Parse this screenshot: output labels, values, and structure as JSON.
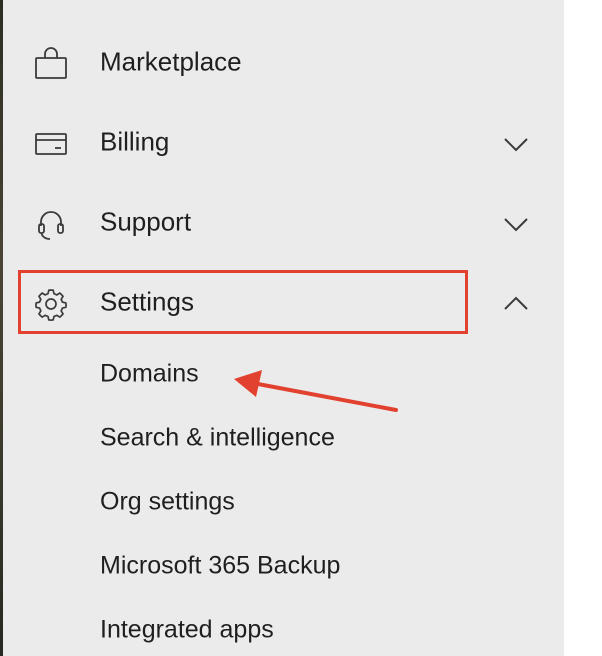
{
  "nav": {
    "items": [
      {
        "label": "Marketplace",
        "icon": "shopping-bag-icon",
        "chevron": "none"
      },
      {
        "label": "Billing",
        "icon": "credit-card-icon",
        "chevron": "down"
      },
      {
        "label": "Support",
        "icon": "headset-icon",
        "chevron": "down"
      },
      {
        "label": "Settings",
        "icon": "gear-icon",
        "chevron": "up",
        "expanded": true
      }
    ],
    "settings_subitems": [
      {
        "label": "Domains"
      },
      {
        "label": "Search & intelligence"
      },
      {
        "label": "Org settings"
      },
      {
        "label": "Microsoft 365 Backup"
      },
      {
        "label": "Integrated apps"
      }
    ]
  },
  "annotation": {
    "highlight_color": "#e2412f",
    "highlight_target": "Settings",
    "arrow_target": "Domains"
  },
  "colors": {
    "panel_bg": "#ebebeb",
    "text": "#1f1f1f",
    "icon": "#3b3b3b"
  }
}
